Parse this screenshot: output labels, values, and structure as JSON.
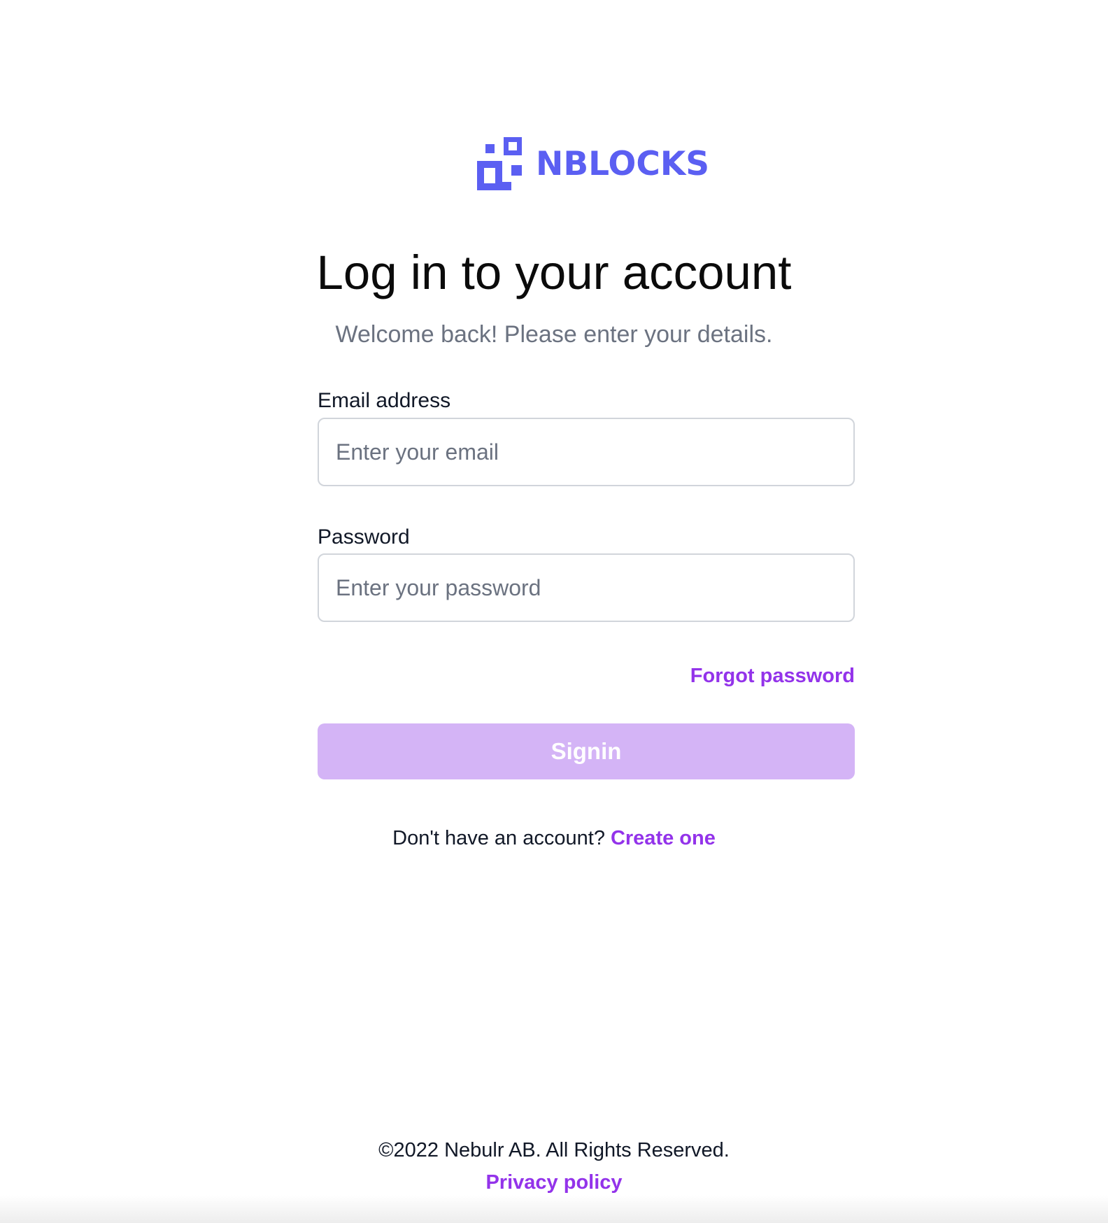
{
  "brand": {
    "logo_text": "NBLOCKS",
    "logo_icon": "blocks-logo-icon",
    "color": "#5b5ff2"
  },
  "header": {
    "title": "Log in to your account",
    "subtitle": "Welcome back! Please enter your details."
  },
  "form": {
    "email": {
      "label": "Email address",
      "placeholder": "Enter your email",
      "value": ""
    },
    "password": {
      "label": "Password",
      "placeholder": "Enter your password",
      "value": ""
    },
    "forgot_password_label": "Forgot password",
    "signin_label": "Signin",
    "signin_color": "#d4b4f6"
  },
  "signup": {
    "prompt": "Don't have an account?",
    "link_label": "Create one"
  },
  "footer": {
    "copyright": "©2022 Nebulr AB. All Rights Reserved.",
    "privacy_label": "Privacy policy"
  },
  "colors": {
    "accent": "#9333ea",
    "muted_text": "#6b7280",
    "border": "#d1d5db"
  }
}
